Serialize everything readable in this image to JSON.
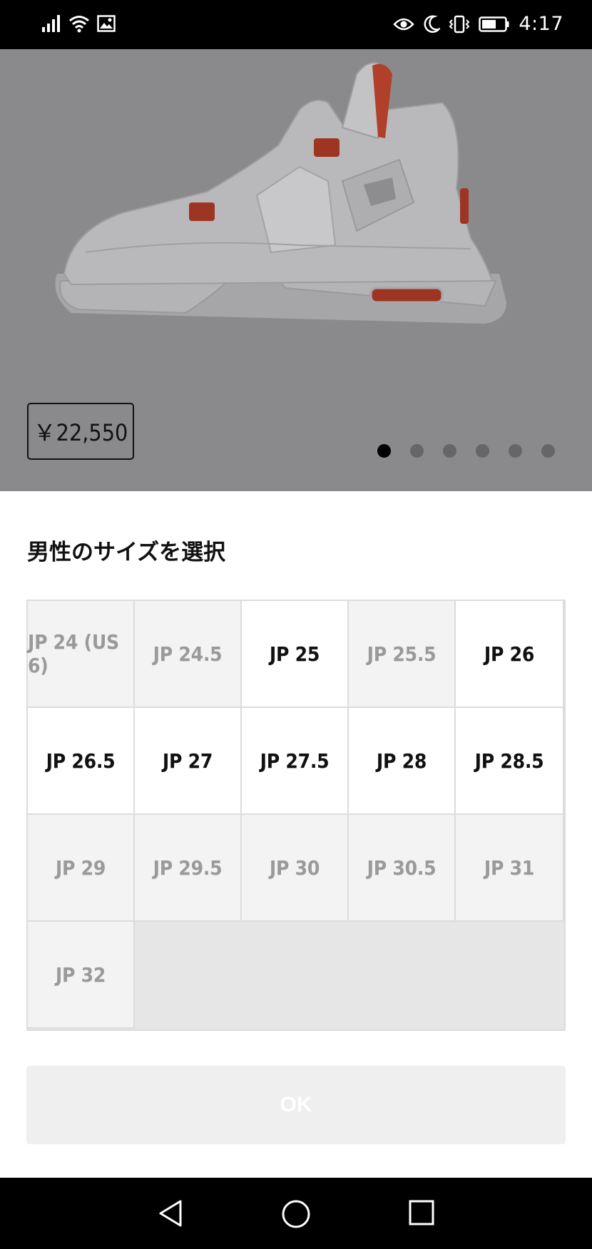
{
  "status_bar": {
    "time": "4:17",
    "left_icons": [
      "signal-icon",
      "wifi-icon",
      "image-notification-icon"
    ],
    "right_icons": [
      "eye-comfort-icon",
      "moon-icon",
      "vibrate-icon",
      "battery-icon"
    ]
  },
  "product": {
    "price": "￥22,550",
    "image_count": 6,
    "active_image_index": 0
  },
  "size_sheet": {
    "title": "男性のサイズを選択",
    "sizes": [
      {
        "label": "JP 24 (US 6)",
        "available": false
      },
      {
        "label": "JP 24.5",
        "available": false
      },
      {
        "label": "JP 25",
        "available": true
      },
      {
        "label": "JP 25.5",
        "available": false
      },
      {
        "label": "JP 26",
        "available": true
      },
      {
        "label": "JP 26.5",
        "available": true
      },
      {
        "label": "JP 27",
        "available": true
      },
      {
        "label": "JP 27.5",
        "available": true
      },
      {
        "label": "JP 28",
        "available": true
      },
      {
        "label": "JP 28.5",
        "available": true
      },
      {
        "label": "JP 29",
        "available": false
      },
      {
        "label": "JP 29.5",
        "available": false
      },
      {
        "label": "JP 30",
        "available": false
      },
      {
        "label": "JP 30.5",
        "available": false
      },
      {
        "label": "JP 31",
        "available": false
      },
      {
        "label": "JP 32",
        "available": false
      }
    ],
    "ok_label": "OK"
  },
  "nav_bar": {
    "buttons": [
      "back-icon",
      "home-icon",
      "recents-icon"
    ]
  },
  "colors": {
    "overlay_gray": "#8a8a8d",
    "available_text": "#111111",
    "unavailable_text": "#9a9a9a",
    "ok_button_bg": "#efefef"
  }
}
